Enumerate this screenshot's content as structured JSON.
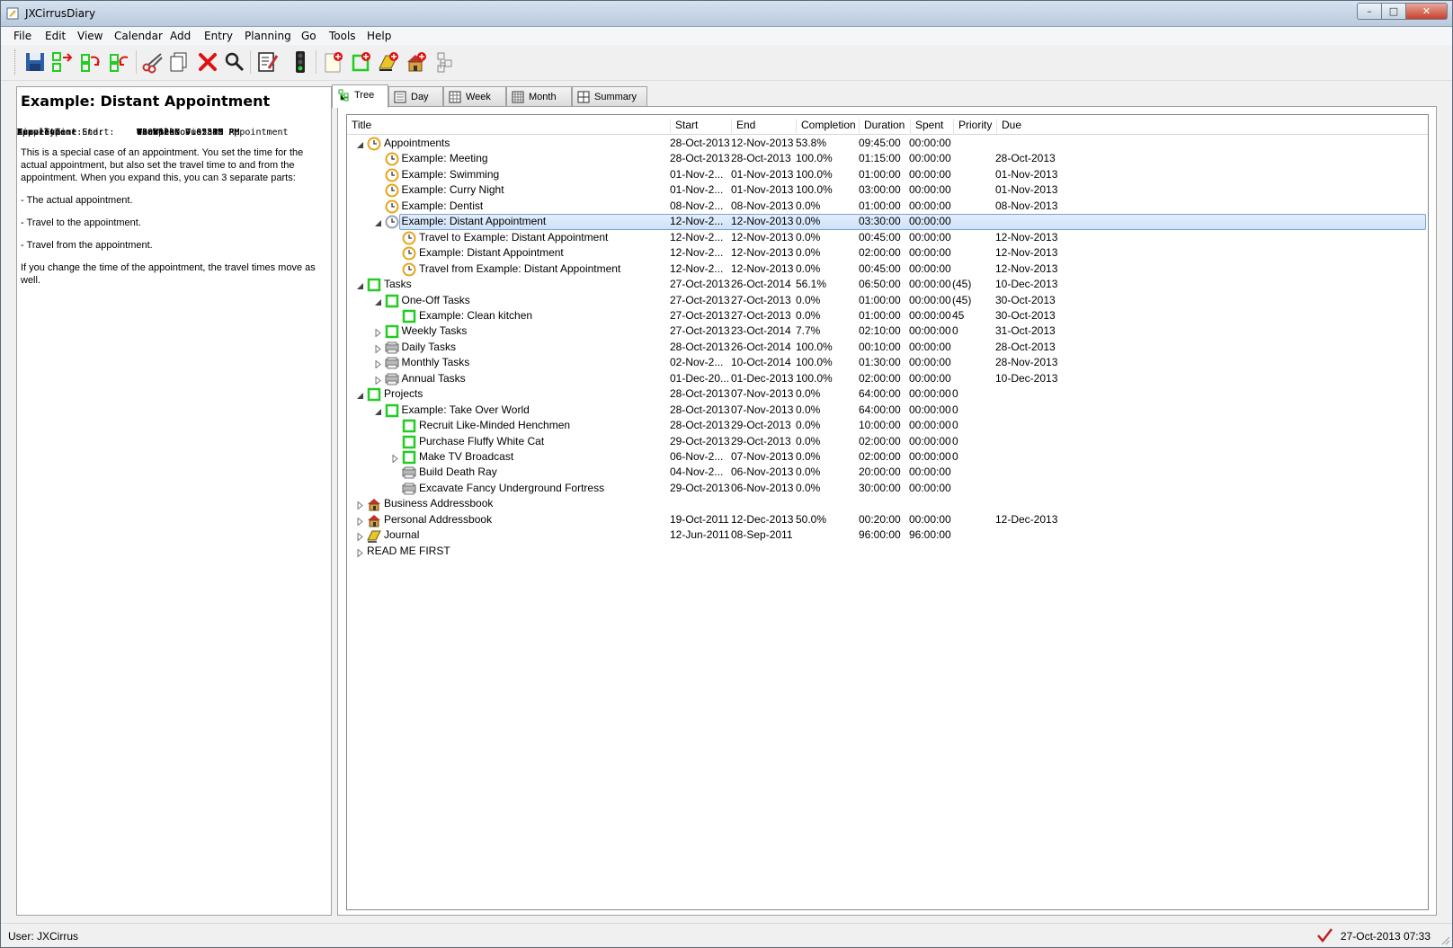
{
  "window": {
    "title": "JXCirrusDiary",
    "controls": {
      "minimize": "–",
      "maximize": "□",
      "close": "✕"
    }
  },
  "menu": [
    "File",
    "Edit",
    "View",
    "Calendar",
    "Add",
    "Entry",
    "Planning",
    "Go",
    "Tools",
    "Help"
  ],
  "toolbar": [
    {
      "name": "save-icon"
    },
    {
      "name": "export-icon"
    },
    {
      "name": "sync-icon"
    },
    {
      "name": "import-icon"
    },
    {
      "name": "cut-icon"
    },
    {
      "name": "copy-icon"
    },
    {
      "name": "delete-icon"
    },
    {
      "name": "search-icon"
    },
    {
      "name": "edit-notes-icon"
    },
    {
      "name": "traffic-light-icon"
    },
    {
      "name": "new-note-icon"
    },
    {
      "name": "new-task-icon"
    },
    {
      "name": "new-journal-icon"
    },
    {
      "name": "new-addressbook-icon"
    },
    {
      "name": "tree-structure-icon"
    }
  ],
  "details": {
    "heading": "Example: Distant Appointment",
    "fields": [
      {
        "key": "Time:",
        "value": "Tue 12-Nov 02:15 PM"
      },
      {
        "key": "",
        "value": "Tue 12-Nov 05:45 PM"
      },
      {
        "key": "Duration:",
        "value": "03:30:00"
      },
      {
        "key": "Completion:",
        "value": "0.0 %"
      },
      {
        "key": "Time Type:",
        "value": "Work"
      },
      {
        "key": "Appointment:",
        "value": "Example: Distant Appointment"
      },
      {
        "key": "Appointment Start:",
        "value": "+3 Weeks Tue 3PM"
      },
      {
        "key": "Appointment End:",
        "value": "+3 Weeks Tue 5PM"
      },
      {
        "key": "Travel Time:",
        "value": "45 mins"
      }
    ],
    "paragraphs": [
      "This is a special case of an appointment. You set the time for the actual appointment, but also set the travel time to and from the appointment. When you expand this, you can 3 separate parts:",
      "- The actual appointment.",
      "- Travel to the appointment.",
      "- Travel from the appointment.",
      "If you change the time of the appointment, the travel times move as well."
    ]
  },
  "tabs": [
    {
      "label": "Tree",
      "icon": "tree-icon",
      "active": true
    },
    {
      "label": "Day",
      "icon": "day-icon"
    },
    {
      "label": "Week",
      "icon": "week-icon"
    },
    {
      "label": "Month",
      "icon": "month-icon"
    },
    {
      "label": "Summary",
      "icon": "summary-icon"
    }
  ],
  "columns": [
    "Title",
    "Start",
    "End",
    "Completion",
    "Duration",
    "Spent",
    "Priority",
    "Due"
  ],
  "rows": [
    {
      "level": 0,
      "exp": "open",
      "icon": "clock",
      "title": "Appointments",
      "start": "28-Oct-2013",
      "end": "12-Nov-2013",
      "completion": "53.8%",
      "duration": "09:45:00",
      "spent": "00:00:00",
      "priority": "",
      "due": ""
    },
    {
      "level": 1,
      "exp": "",
      "icon": "clock",
      "title": "Example: Meeting",
      "start": "28-Oct-2013",
      "end": "28-Oct-2013",
      "completion": "100.0%",
      "duration": "01:15:00",
      "spent": "00:00:00",
      "priority": "",
      "due": "28-Oct-2013"
    },
    {
      "level": 1,
      "exp": "",
      "icon": "clock",
      "title": "Example: Swimming",
      "start": "01-Nov-2...",
      "end": "01-Nov-2013",
      "completion": "100.0%",
      "duration": "01:00:00",
      "spent": "00:00:00",
      "priority": "",
      "due": "01-Nov-2013"
    },
    {
      "level": 1,
      "exp": "",
      "icon": "clock",
      "title": "Example: Curry Night",
      "start": "01-Nov-2...",
      "end": "01-Nov-2013",
      "completion": "100.0%",
      "duration": "03:00:00",
      "spent": "00:00:00",
      "priority": "",
      "due": "01-Nov-2013"
    },
    {
      "level": 1,
      "exp": "",
      "icon": "clock",
      "title": "Example: Dentist",
      "start": "08-Nov-2...",
      "end": "08-Nov-2013",
      "completion": "0.0%",
      "duration": "01:00:00",
      "spent": "00:00:00",
      "priority": "",
      "due": "08-Nov-2013"
    },
    {
      "level": 1,
      "exp": "open",
      "icon": "clock-grey",
      "title": "Example: Distant Appointment",
      "start": "12-Nov-2...",
      "end": "12-Nov-2013",
      "completion": "0.0%",
      "duration": "03:30:00",
      "spent": "00:00:00",
      "priority": "",
      "due": "",
      "selected": true
    },
    {
      "level": 2,
      "exp": "",
      "icon": "clock",
      "title": "Travel to Example: Distant Appointment",
      "start": "12-Nov-2...",
      "end": "12-Nov-2013",
      "completion": "0.0%",
      "duration": "00:45:00",
      "spent": "00:00:00",
      "priority": "",
      "due": "12-Nov-2013"
    },
    {
      "level": 2,
      "exp": "",
      "icon": "clock",
      "title": "Example: Distant Appointment",
      "start": "12-Nov-2...",
      "end": "12-Nov-2013",
      "completion": "0.0%",
      "duration": "02:00:00",
      "spent": "00:00:00",
      "priority": "",
      "due": "12-Nov-2013"
    },
    {
      "level": 2,
      "exp": "",
      "icon": "clock",
      "title": "Travel from Example: Distant Appointment",
      "start": "12-Nov-2...",
      "end": "12-Nov-2013",
      "completion": "0.0%",
      "duration": "00:45:00",
      "spent": "00:00:00",
      "priority": "",
      "due": "12-Nov-2013"
    },
    {
      "level": 0,
      "exp": "open",
      "icon": "task",
      "title": "Tasks",
      "start": "27-Oct-2013",
      "end": "26-Oct-2014",
      "completion": "56.1%",
      "duration": "06:50:00",
      "spent": "00:00:00",
      "priority": "(45)",
      "due": "10-Dec-2013"
    },
    {
      "level": 1,
      "exp": "open",
      "icon": "task",
      "title": "One-Off Tasks",
      "start": "27-Oct-2013",
      "end": "27-Oct-2013",
      "completion": "0.0%",
      "duration": "01:00:00",
      "spent": "00:00:00",
      "priority": "(45)",
      "due": "30-Oct-2013"
    },
    {
      "level": 2,
      "exp": "",
      "icon": "task",
      "title": "Example: Clean kitchen",
      "start": "27-Oct-2013",
      "end": "27-Oct-2013",
      "completion": "0.0%",
      "duration": "01:00:00",
      "spent": "00:00:00",
      "priority": "45",
      "due": "30-Oct-2013"
    },
    {
      "level": 1,
      "exp": "closed",
      "icon": "task",
      "title": "Weekly Tasks",
      "start": "27-Oct-2013",
      "end": "23-Oct-2014",
      "completion": "7.7%",
      "duration": "02:10:00",
      "spent": "00:00:00",
      "priority": "0",
      "due": "31-Oct-2013"
    },
    {
      "level": 1,
      "exp": "closed",
      "icon": "recurring",
      "title": "Daily Tasks",
      "start": "28-Oct-2013",
      "end": "26-Oct-2014",
      "completion": "100.0%",
      "duration": "00:10:00",
      "spent": "00:00:00",
      "priority": "",
      "due": "28-Oct-2013"
    },
    {
      "level": 1,
      "exp": "closed",
      "icon": "recurring",
      "title": "Monthly Tasks",
      "start": "02-Nov-2...",
      "end": "10-Oct-2014",
      "completion": "100.0%",
      "duration": "01:30:00",
      "spent": "00:00:00",
      "priority": "",
      "due": "28-Nov-2013"
    },
    {
      "level": 1,
      "exp": "closed",
      "icon": "recurring",
      "title": "Annual Tasks",
      "start": "01-Dec-20...",
      "end": "01-Dec-2013",
      "completion": "100.0%",
      "duration": "02:00:00",
      "spent": "00:00:00",
      "priority": "",
      "due": "10-Dec-2013"
    },
    {
      "level": 0,
      "exp": "open",
      "icon": "task",
      "title": "Projects",
      "start": "28-Oct-2013",
      "end": "07-Nov-2013",
      "completion": "0.0%",
      "duration": "64:00:00",
      "spent": "00:00:00",
      "priority": "0",
      "due": ""
    },
    {
      "level": 1,
      "exp": "open",
      "icon": "task",
      "title": "Example: Take Over World",
      "start": "28-Oct-2013",
      "end": "07-Nov-2013",
      "completion": "0.0%",
      "duration": "64:00:00",
      "spent": "00:00:00",
      "priority": "0",
      "due": ""
    },
    {
      "level": 2,
      "exp": "",
      "icon": "task",
      "title": "Recruit Like-Minded Henchmen",
      "start": "28-Oct-2013",
      "end": "29-Oct-2013",
      "completion": "0.0%",
      "duration": "10:00:00",
      "spent": "00:00:00",
      "priority": "0",
      "due": ""
    },
    {
      "level": 2,
      "exp": "",
      "icon": "task",
      "title": "Purchase Fluffy White Cat",
      "start": "29-Oct-2013",
      "end": "29-Oct-2013",
      "completion": "0.0%",
      "duration": "02:00:00",
      "spent": "00:00:00",
      "priority": "0",
      "due": ""
    },
    {
      "level": 2,
      "exp": "closed",
      "icon": "task",
      "title": "Make TV Broadcast",
      "start": "06-Nov-2...",
      "end": "07-Nov-2013",
      "completion": "0.0%",
      "duration": "02:00:00",
      "spent": "00:00:00",
      "priority": "0",
      "due": ""
    },
    {
      "level": 2,
      "exp": "",
      "icon": "recurring",
      "title": "Build Death Ray",
      "start": "04-Nov-2...",
      "end": "06-Nov-2013",
      "completion": "0.0%",
      "duration": "20:00:00",
      "spent": "00:00:00",
      "priority": "",
      "due": ""
    },
    {
      "level": 2,
      "exp": "",
      "icon": "recurring",
      "title": "Excavate Fancy Underground Fortress",
      "start": "29-Oct-2013",
      "end": "06-Nov-2013",
      "completion": "0.0%",
      "duration": "30:00:00",
      "spent": "00:00:00",
      "priority": "",
      "due": ""
    },
    {
      "level": 0,
      "exp": "closed",
      "icon": "house",
      "title": "Business Addressbook",
      "start": "",
      "end": "",
      "completion": "",
      "duration": "",
      "spent": "",
      "priority": "",
      "due": ""
    },
    {
      "level": 0,
      "exp": "closed",
      "icon": "house",
      "title": "Personal Addressbook",
      "start": "19-Oct-2011",
      "end": "12-Dec-2013",
      "completion": "50.0%",
      "duration": "00:20:00",
      "spent": "00:00:00",
      "priority": "",
      "due": "12-Dec-2013"
    },
    {
      "level": 0,
      "exp": "closed",
      "icon": "journal",
      "title": "Journal",
      "start": "12-Jun-2011",
      "end": "08-Sep-2011",
      "completion": "",
      "duration": "96:00:00",
      "spent": "96:00:00",
      "priority": "",
      "due": ""
    },
    {
      "level": 0,
      "exp": "closed",
      "icon": "none",
      "title": "READ ME FIRST",
      "start": "",
      "end": "",
      "completion": "",
      "duration": "",
      "spent": "",
      "priority": "",
      "due": ""
    }
  ],
  "status": {
    "user": "User: JXCirrus",
    "datetime": "27-Oct-2013 07:33"
  },
  "colors": {
    "accent": "#7da2ce",
    "task_green": "#22cc22",
    "clock_orange": "#e8a317",
    "delete_red": "#e01010"
  }
}
